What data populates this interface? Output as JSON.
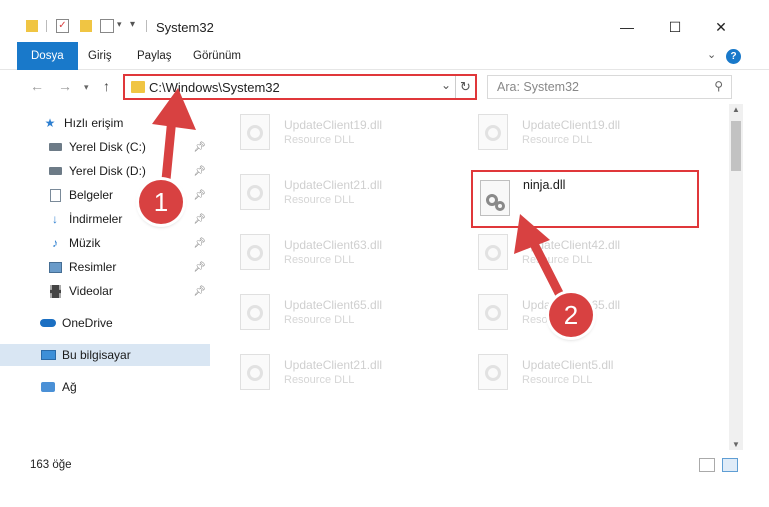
{
  "window": {
    "title": "System32",
    "minimize": "—",
    "maximize": "☐",
    "close": "✕"
  },
  "ribbon": {
    "tabs": [
      "Dosya",
      "Giriş",
      "Paylaş",
      "Görünüm"
    ],
    "expand_icon": "chevron-down-icon",
    "help_label": "?"
  },
  "address": {
    "path": "C:\\Windows\\System32",
    "search_placeholder": "Ara: System32"
  },
  "sidebar": {
    "items": [
      {
        "label": "Hızlı erişim",
        "icon": "star-icon",
        "pinned": false
      },
      {
        "label": "Yerel Disk (C:)",
        "icon": "drive-icon",
        "pinned": true
      },
      {
        "label": "Yerel Disk (D:)",
        "icon": "drive-icon",
        "pinned": true
      },
      {
        "label": "Belgeler",
        "icon": "documents-icon",
        "pinned": true
      },
      {
        "label": "İndirmeler",
        "icon": "download-icon",
        "pinned": true
      },
      {
        "label": "Müzik",
        "icon": "music-icon",
        "pinned": true
      },
      {
        "label": "Resimler",
        "icon": "pictures-icon",
        "pinned": true
      },
      {
        "label": "Videolar",
        "icon": "video-icon",
        "pinned": true
      },
      {
        "label": "OneDrive",
        "icon": "cloud-icon",
        "pinned": false
      },
      {
        "label": "Bu bilgisayar",
        "icon": "computer-icon",
        "pinned": false,
        "selected": true
      },
      {
        "label": "Ağ",
        "icon": "network-icon",
        "pinned": false
      }
    ]
  },
  "files": [
    {
      "name": "UpdateClient19.dll",
      "type": "Resource DLL"
    },
    {
      "name": "UpdateClient19.dll",
      "type": "Resource DLL"
    },
    {
      "name": "UpdateClient21.dll",
      "type": "Resource DLL"
    },
    {
      "name": "ninja.dll",
      "type": ""
    },
    {
      "name": "UpdateClient63.dll",
      "type": "Resource DLL"
    },
    {
      "name": "UpdateClient42.dll",
      "type": "Resource DLL"
    },
    {
      "name": "UpdateClient65.dll",
      "type": "Resource DLL"
    },
    {
      "name": "UpdateClient65.dll",
      "type": "Resource DLL"
    },
    {
      "name": "UpdateClient21.dll",
      "type": "Resource DLL"
    },
    {
      "name": "UpdateClient5.dll",
      "type": "Resource DLL"
    }
  ],
  "status": {
    "count": "163 öğe"
  },
  "callouts": [
    "1",
    "2"
  ],
  "colors": {
    "accent": "#1979ca",
    "highlight": "#e0373a",
    "selected_nav": "#d9e6f3"
  }
}
